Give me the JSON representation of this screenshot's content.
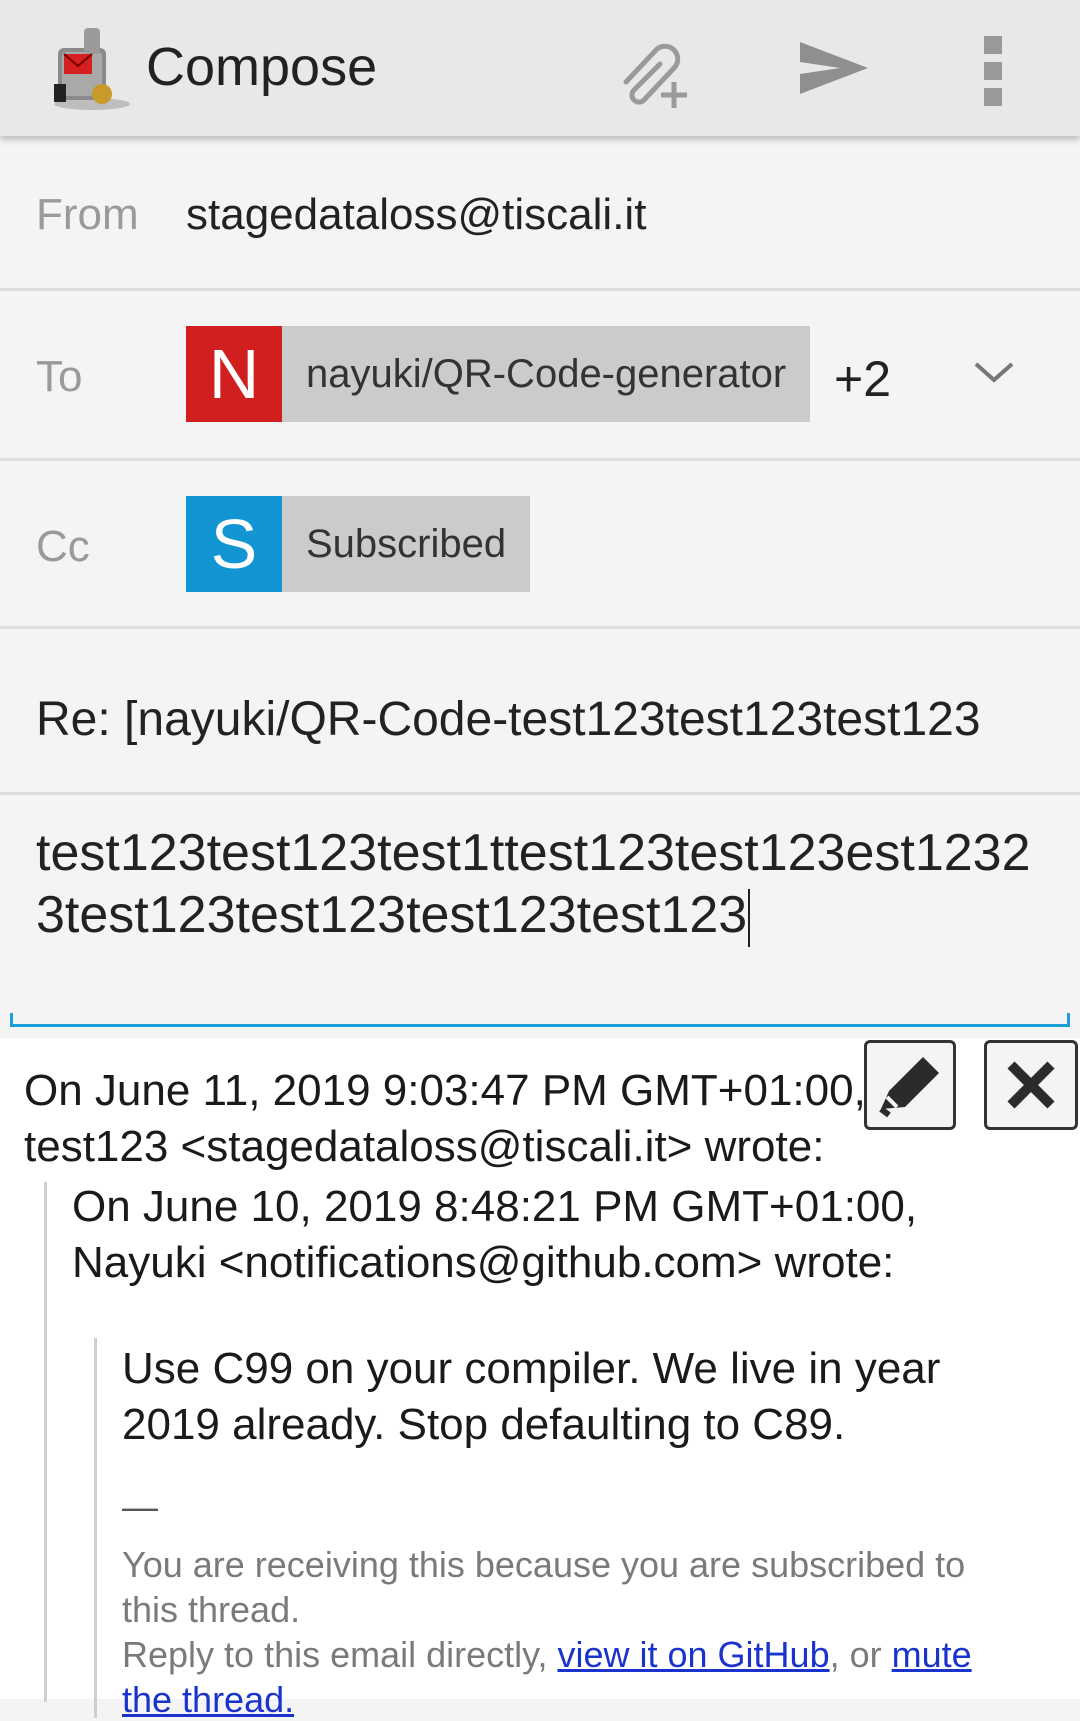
{
  "app_bar": {
    "title": "Compose",
    "icons": [
      "app-logo-icon",
      "attach-add-icon",
      "send-icon",
      "overflow-menu-icon"
    ]
  },
  "from": {
    "label": "From",
    "value": "stagedataloss@tiscali.it"
  },
  "to": {
    "label": "To",
    "chip": {
      "initial": "N",
      "label": "nayuki/QR-Code-generator",
      "color": "#d11f1f"
    },
    "more": "+2"
  },
  "cc": {
    "label": "Cc",
    "chip": {
      "initial": "S",
      "label": "Subscribed",
      "color": "#1296d3"
    }
  },
  "subject": "Re: [nayuki/QR-Code-test123test123test123",
  "body": "test123test123test1ttest123test123est12323test123test123test123test123",
  "quoted": {
    "line1": "On June 11, 2019 9:03:47 PM GMT+01:00,",
    "line2": "test123 <stagedataloss@tiscali.it> wrote:",
    "line3": "On June 10, 2019 8:48:21 PM GMT+01:00,",
    "line4": "Nayuki <notifications@github.com> wrote:",
    "line5": "Use C99 on your compiler. We live in year",
    "line6": "2019 already. Stop defaulting to C89.",
    "dash": "—",
    "line7": "You are receiving this because you are subscribed to",
    "line8": "this thread.",
    "line9_prefix": "Reply to this email directly, ",
    "link1": "view it on GitHub",
    "line9_mid": ", or ",
    "link2": "mute",
    "line10": "the thread."
  },
  "accent_color": "#1aa0d8"
}
